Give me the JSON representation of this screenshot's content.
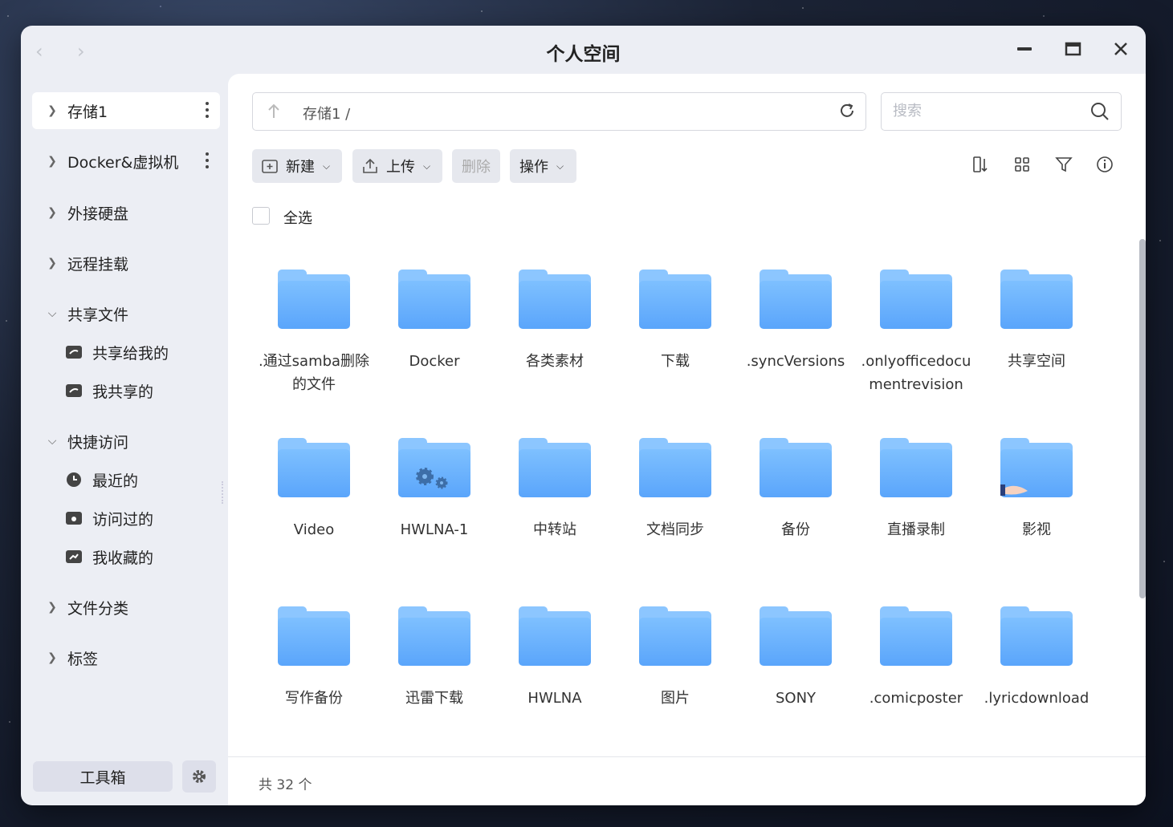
{
  "window": {
    "title": "个人空间"
  },
  "sidebar": {
    "items": [
      {
        "label": "存储1",
        "expanded": false,
        "active": true
      },
      {
        "label": "Docker&虚拟机",
        "expanded": false
      },
      {
        "label": "外接硬盘",
        "expanded": false
      },
      {
        "label": "远程挂载",
        "expanded": false
      },
      {
        "label": "共享文件",
        "expanded": true
      },
      {
        "label": "快捷访问",
        "expanded": true
      },
      {
        "label": "文件分类",
        "expanded": false
      },
      {
        "label": "标签",
        "expanded": false
      }
    ],
    "shared": [
      {
        "label": "共享给我的",
        "icon": "shared-to-me-icon"
      },
      {
        "label": "我共享的",
        "icon": "my-shares-icon"
      }
    ],
    "quick": [
      {
        "label": "最近的",
        "icon": "clock-icon"
      },
      {
        "label": "访问过的",
        "icon": "visited-icon"
      },
      {
        "label": "我收藏的",
        "icon": "favorites-icon"
      }
    ],
    "toolbox_label": "工具箱"
  },
  "path": {
    "current": "存储1 /"
  },
  "search": {
    "placeholder": "搜索"
  },
  "toolbar": {
    "new_label": "新建",
    "upload_label": "上传",
    "delete_label": "删除",
    "actions_label": "操作"
  },
  "select_all_label": "全选",
  "folders": [
    {
      "name": ".通过samba删除的文件"
    },
    {
      "name": "Docker"
    },
    {
      "name": "各类素材"
    },
    {
      "name": "下载"
    },
    {
      "name": ".syncVersions"
    },
    {
      "name": ".onlyofficedocumentrevision"
    },
    {
      "name": "共享空间"
    },
    {
      "name": "Video"
    },
    {
      "name": "HWLNA-1",
      "badge": "gears-icon"
    },
    {
      "name": "中转站"
    },
    {
      "name": "文档同步"
    },
    {
      "name": "备份"
    },
    {
      "name": "直播录制"
    },
    {
      "name": "影视",
      "badge": "shared-hand-icon"
    },
    {
      "name": "写作备份"
    },
    {
      "name": "迅雷下载"
    },
    {
      "name": "HWLNA"
    },
    {
      "name": "图片"
    },
    {
      "name": "SONY"
    },
    {
      "name": ".comicposter"
    },
    {
      "name": ".lyricdownload"
    }
  ],
  "footer": {
    "count_text": "共 32 个"
  },
  "colors": {
    "folder_top": "#7ec0ff",
    "folder_bottom": "#5aa5fb",
    "sidebar_bg": "#eceef4",
    "active_item_bg": "#ffffff"
  }
}
